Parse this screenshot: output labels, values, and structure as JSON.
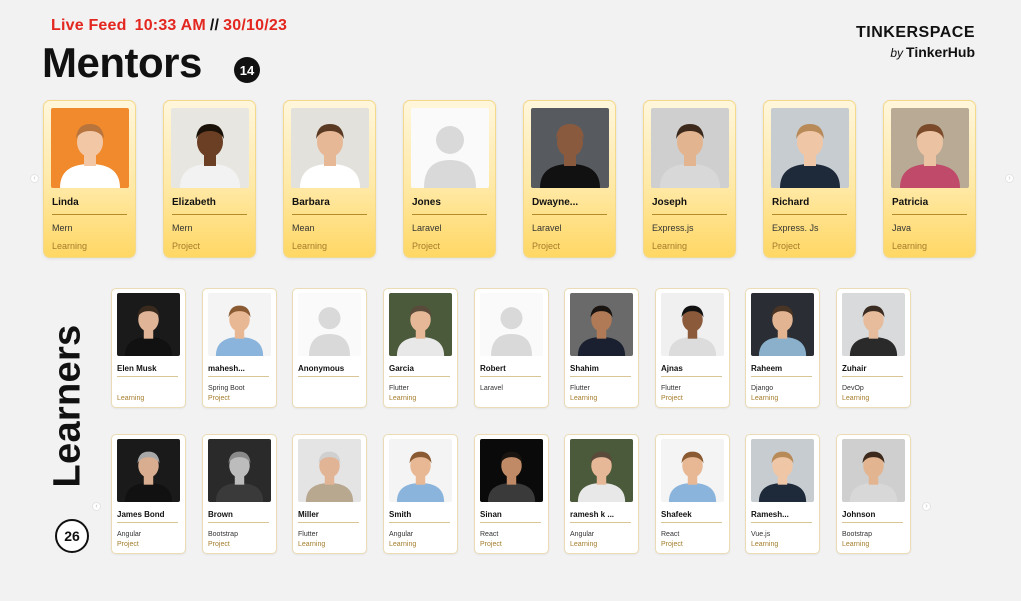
{
  "header": {
    "live_label": "Live Feed",
    "time": "10:33 AM",
    "separator": "//",
    "date": "30/10/23"
  },
  "brand": {
    "name": "TINKERSPACE",
    "by": "by",
    "hub": "TinkerHub"
  },
  "mentors": {
    "title": "Mentors",
    "count": "14",
    "items": [
      {
        "name": "Linda",
        "stack": "Mern",
        "mode": "Learning",
        "bg": "#f08a2c",
        "skin": "#f2c7a6",
        "hair": "#b8743d",
        "shirt": "#ffffff"
      },
      {
        "name": "Elizabeth",
        "stack": "Mern",
        "mode": "Project",
        "bg": "#e8e6e1",
        "skin": "#6b3f24",
        "hair": "#1a1208",
        "shirt": "#f2f2f2"
      },
      {
        "name": "Barbara",
        "stack": "Mean",
        "mode": "Learning",
        "bg": "#e3e1dc",
        "skin": "#e6b896",
        "hair": "#5a3a22",
        "shirt": "#ffffff"
      },
      {
        "name": "Jones",
        "stack": "Laravel",
        "mode": "Project",
        "bg": "#fafafa",
        "skin": "#e6e6e6",
        "hair": "#dcdcdc",
        "shirt": "#e0e0e0"
      },
      {
        "name": "Dwayne...",
        "stack": "Laravel",
        "mode": "Project",
        "bg": "#575a5e",
        "skin": "#8a5a3f",
        "hair": "#8a5a3f",
        "shirt": "#111111"
      },
      {
        "name": "Joseph",
        "stack": "Express.js",
        "mode": "Learning",
        "bg": "#cfcfcf",
        "skin": "#e2b48f",
        "hair": "#3d2a1c",
        "shirt": "#d8d8d8"
      },
      {
        "name": "Richard",
        "stack": "Express. Js",
        "mode": "Project",
        "bg": "#c7ccd1",
        "skin": "#efc6a6",
        "hair": "#b88a58",
        "shirt": "#1e2a3a"
      },
      {
        "name": "Patricia",
        "stack": "Java",
        "mode": "Learning",
        "bg": "#b8aa94",
        "skin": "#ecc3a2",
        "hair": "#7a4a2a",
        "shirt": "#c04a6a"
      }
    ]
  },
  "learners": {
    "title": "Learners",
    "count": "26",
    "row1": [
      {
        "name": "Elen Musk",
        "stack": "",
        "mode": "Learning",
        "bg": "#1a1a1a",
        "skin": "#e0b497",
        "hair": "#3a2a1e",
        "shirt": "#111111"
      },
      {
        "name": "mahesh...",
        "stack": "Spring Boot",
        "mode": "Project",
        "bg": "#f4f4f4",
        "skin": "#e8b894",
        "hair": "#8a5a32",
        "shirt": "#8ab4dc"
      },
      {
        "name": "Anonymous",
        "stack": "",
        "mode": "",
        "bg": "#fafafa",
        "skin": "#e6e6e6",
        "hair": "#dcdcdc",
        "shirt": "#e0e0e0"
      },
      {
        "name": "Garcia",
        "stack": "Flutter",
        "mode": "Learning",
        "bg": "#4a5a3a",
        "skin": "#e6b897",
        "hair": "#5a4a3a",
        "shirt": "#e8e8e8"
      },
      {
        "name": "Robert",
        "stack": "Laravel",
        "mode": "",
        "bg": "#fafafa",
        "skin": "#e6e6e6",
        "hair": "#dcdcdc",
        "shirt": "#e0e0e0"
      },
      {
        "name": "Shahim",
        "stack": "Flutter",
        "mode": "Learning",
        "bg": "#6a6a6a",
        "skin": "#b07a56",
        "hair": "#1a1410",
        "shirt": "#1a2030"
      },
      {
        "name": "Ajnas",
        "stack": "Flutter",
        "mode": "Project",
        "bg": "#f0f0f0",
        "skin": "#8a5a3a",
        "hair": "#111111",
        "shirt": "#dcdcdc"
      },
      {
        "name": "Raheem",
        "stack": "Django",
        "mode": "Learning",
        "bg": "#2a2e34",
        "skin": "#e2b492",
        "hair": "#4a3424",
        "shirt": "#8ab0cc"
      },
      {
        "name": "Zuhair",
        "stack": "DevOp",
        "mode": "Learning",
        "bg": "#d8dadc",
        "skin": "#e6bc9c",
        "hair": "#3a2c22",
        "shirt": "#2a2a2a"
      }
    ],
    "row2": [
      {
        "name": "James Bond",
        "stack": "Angular",
        "mode": "Project",
        "bg": "#1a1a1a",
        "skin": "#d8ad90",
        "hair": "#a8a8a8",
        "shirt": "#111111"
      },
      {
        "name": "Brown",
        "stack": "Bootstrap",
        "mode": "Project",
        "bg": "#2a2a2a",
        "skin": "#bcbcbc",
        "hair": "#8a8a8a",
        "shirt": "#3a3a3a"
      },
      {
        "name": "Miller",
        "stack": "Flutter",
        "mode": "Learning",
        "bg": "#e4e4e4",
        "skin": "#e2b496",
        "hair": "#d0d0d0",
        "shirt": "#b8a890"
      },
      {
        "name": "Smith",
        "stack": "Angular",
        "mode": "Learning",
        "bg": "#f4f4f4",
        "skin": "#e8b894",
        "hair": "#8a5a32",
        "shirt": "#8ab4dc"
      },
      {
        "name": "Sinan",
        "stack": "React",
        "mode": "Project",
        "bg": "#0a0a0a",
        "skin": "#c08a66",
        "hair": "#1a1410",
        "shirt": "#3a3a3a"
      },
      {
        "name": "ramesh k ...",
        "stack": "Angular",
        "mode": "Learning",
        "bg": "#4a5a3a",
        "skin": "#e6b897",
        "hair": "#5a4a3a",
        "shirt": "#e8e8e8"
      },
      {
        "name": "Shafeek",
        "stack": "React",
        "mode": "Project",
        "bg": "#f4f4f4",
        "skin": "#e8b894",
        "hair": "#8a5a32",
        "shirt": "#8ab4dc"
      },
      {
        "name": "Ramesh...",
        "stack": "Vue.js",
        "mode": "Learning",
        "bg": "#c7ccd1",
        "skin": "#efc6a6",
        "hair": "#b88a58",
        "shirt": "#1e2a3a"
      },
      {
        "name": "Johnson",
        "stack": "Bootstrap",
        "mode": "Learning",
        "bg": "#cfcfcf",
        "skin": "#e2b48f",
        "hair": "#3d2a1c",
        "shirt": "#d8d8d8"
      }
    ]
  },
  "icons": {
    "mentor_prev": "chevron-left-icon",
    "mentor_next": "chevron-right-icon",
    "learner_prev": "chevron-left-icon",
    "learner_next": "chevron-right-icon"
  }
}
